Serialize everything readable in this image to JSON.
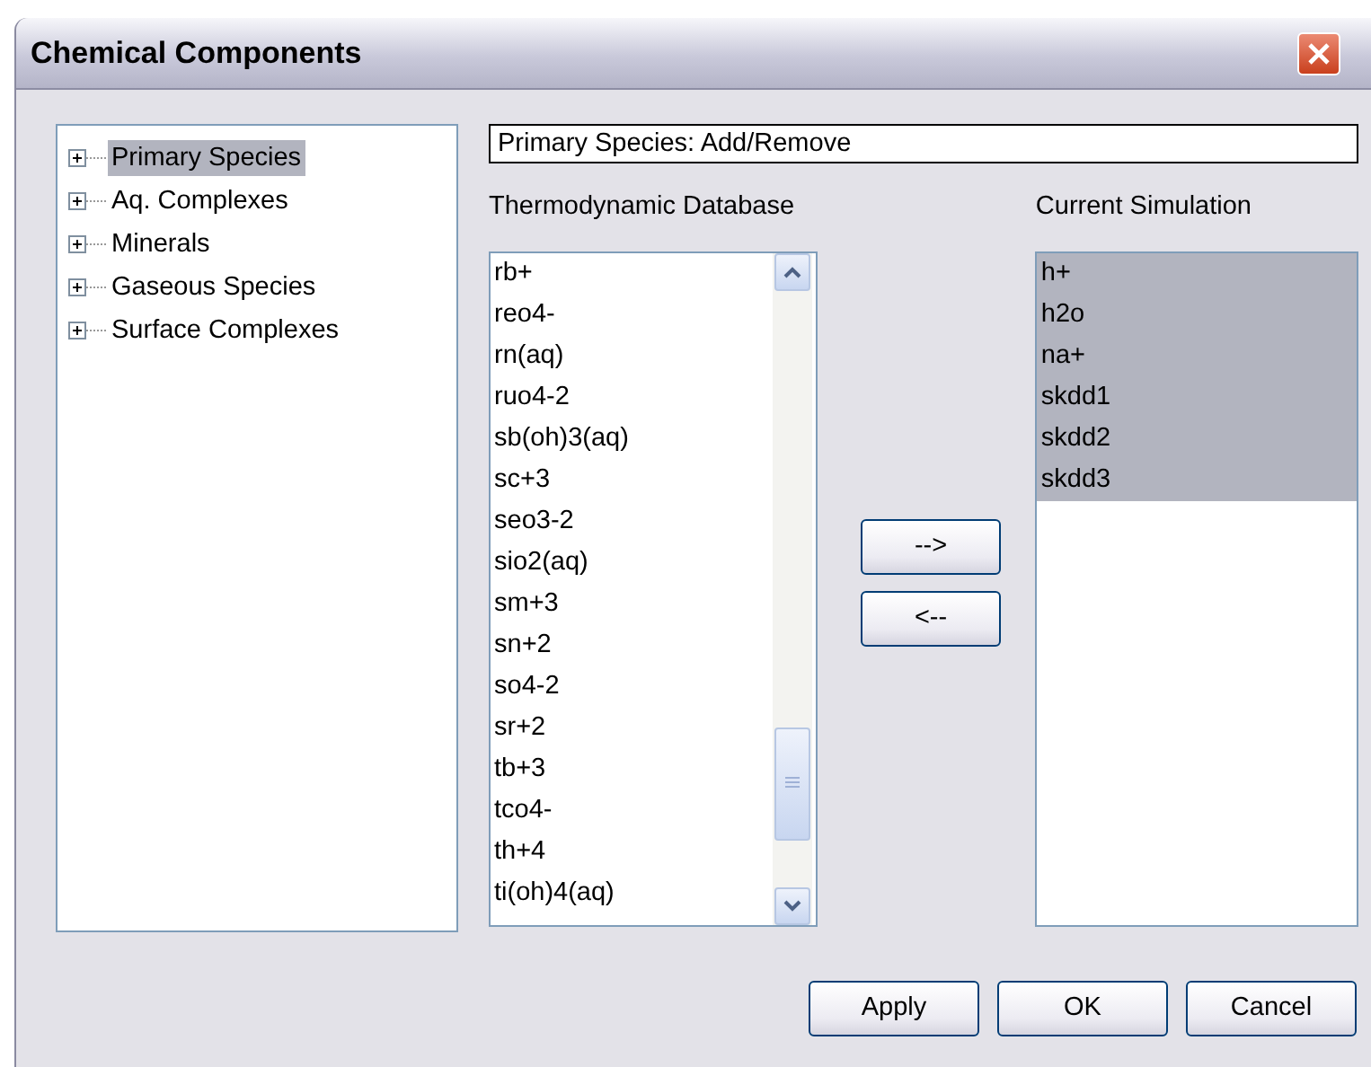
{
  "window": {
    "title": "Chemical Components"
  },
  "tree": {
    "items": [
      {
        "label": "Primary Species",
        "expanded": false,
        "selected": true
      },
      {
        "label": "Aq. Complexes",
        "expanded": false,
        "selected": false
      },
      {
        "label": "Minerals",
        "expanded": false,
        "selected": false
      },
      {
        "label": "Gaseous Species",
        "expanded": false,
        "selected": false
      },
      {
        "label": "Surface Complexes",
        "expanded": false,
        "selected": false
      }
    ]
  },
  "header": {
    "value": "Primary Species: Add/Remove"
  },
  "database": {
    "label": "Thermodynamic Database",
    "items": [
      {
        "label": "rb+",
        "selected": false
      },
      {
        "label": "reo4-",
        "selected": false
      },
      {
        "label": "rn(aq)",
        "selected": false
      },
      {
        "label": "ruo4-2",
        "selected": false
      },
      {
        "label": "sb(oh)3(aq)",
        "selected": false
      },
      {
        "label": "sc+3",
        "selected": false
      },
      {
        "label": "seo3-2",
        "selected": false
      },
      {
        "label": "sio2(aq)",
        "selected": false
      },
      {
        "label": "sm+3",
        "selected": false
      },
      {
        "label": "sn+2",
        "selected": false
      },
      {
        "label": "so4-2",
        "selected": false
      },
      {
        "label": "sr+2",
        "selected": false
      },
      {
        "label": "tb+3",
        "selected": false
      },
      {
        "label": "tco4-",
        "selected": false
      },
      {
        "label": "th+4",
        "selected": false
      },
      {
        "label": "ti(oh)4(aq)",
        "selected": false
      }
    ]
  },
  "move_buttons": [
    "-->",
    "<--"
  ],
  "simulation": {
    "label": "Current Simulation",
    "items": [
      {
        "label": "h+",
        "selected": true
      },
      {
        "label": "h2o",
        "selected": true
      },
      {
        "label": "na+",
        "selected": true
      },
      {
        "label": "skdd1",
        "selected": true
      },
      {
        "label": "skdd2",
        "selected": true
      },
      {
        "label": "skdd3",
        "selected": true
      }
    ]
  },
  "buttons": [
    "Apply",
    "OK",
    "Cancel"
  ]
}
